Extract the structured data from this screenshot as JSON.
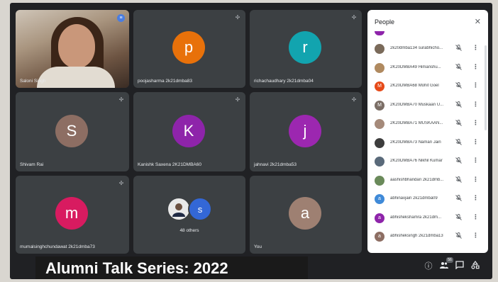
{
  "tiles": [
    {
      "name": "Saloni Singh",
      "type": "video"
    },
    {
      "name": "poojasharma 2k21dmba83",
      "initial": "p",
      "color": "#e8710a"
    },
    {
      "name": "richachaudhary 2k21dmba04",
      "initial": "r",
      "color": "#12a4af"
    },
    {
      "name": "Shivam Rai",
      "initial": "S",
      "color": "#8d6e63"
    },
    {
      "name": "Kanishk Saxena 2K21DMBA60",
      "initial": "K",
      "color": "#8e24aa"
    },
    {
      "name": "jahnavi 2k21dmba53",
      "initial": "j",
      "color": "#9c27b0"
    },
    {
      "name": "mumalsinghchundawat 2k21dmba73",
      "initial": "m",
      "color": "#d81b60"
    },
    {
      "name": "48 others",
      "initial": "s",
      "color": "#3367d6"
    },
    {
      "name": "You",
      "initial": "a",
      "color": "#9e8072"
    }
  ],
  "people": {
    "title": "People",
    "items": [
      {
        "name": "2k20dmba134 surabhicho...",
        "initial": "",
        "color": "#7a6a5a"
      },
      {
        "name": "2K20DMBA49 Himanshu...",
        "initial": "",
        "color": "#b08a60"
      },
      {
        "name": "2K20DMBA68 Mohit Goel",
        "initial": "M",
        "color": "#e64a19"
      },
      {
        "name": "2K20DMBA70 Muskaan U...",
        "initial": "M",
        "color": "#7b6e66"
      },
      {
        "name": "2K20DMBA71 MUSKAAN...",
        "initial": "",
        "color": "#a58a7a"
      },
      {
        "name": "2K20DMBA73 Naman Jain",
        "initial": "",
        "color": "#3d3d3d"
      },
      {
        "name": "2K20DMBA76 Nikhil Kumar",
        "initial": "",
        "color": "#5a6a7a"
      },
      {
        "name": "aashishbhandari 2k21dmb...",
        "initial": "",
        "color": "#6a8a5a"
      },
      {
        "name": "abhinavjain 2k21dmba09",
        "initial": "a",
        "color": "#3f8ad8"
      },
      {
        "name": "abhishekshamra 2k21dm...",
        "initial": "a",
        "color": "#8e24aa"
      },
      {
        "name": "abhisheksingh 2k21dmba13",
        "initial": "a",
        "color": "#8d6e63"
      }
    ]
  },
  "banner": "Alumni Talk Series: 2022",
  "controls": {
    "people_count": "56"
  },
  "icons": {
    "pin": "pin-icon",
    "close": "close-icon",
    "mic_off": "mic-off-icon",
    "more": "more-vert-icon",
    "info": "info-icon",
    "people": "people-icon",
    "chat": "chat-icon",
    "activities": "activities-icon"
  }
}
